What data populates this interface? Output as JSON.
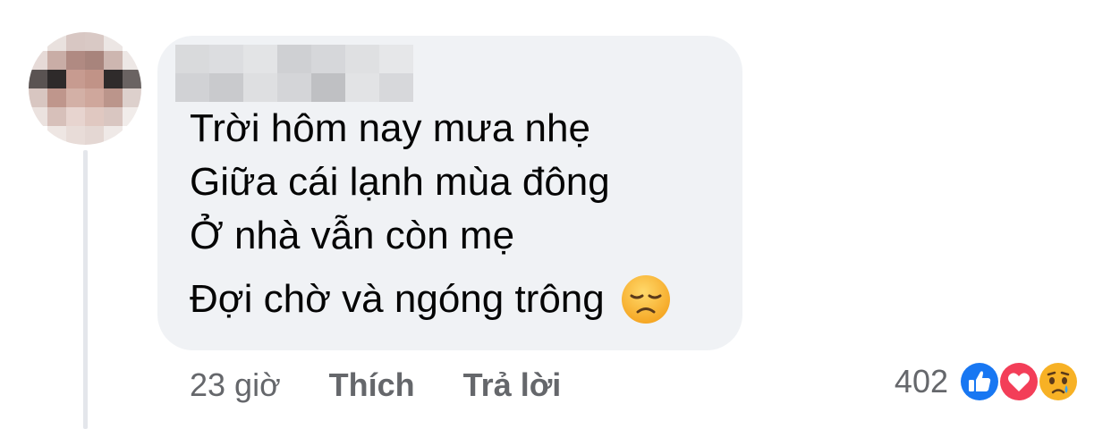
{
  "comment": {
    "lines": [
      "Trời hôm nay mưa nhẹ",
      "Giữa cái lạnh mùa đông",
      "Ở nhà vẫn còn mẹ",
      "Đợi chờ và ngóng trông"
    ],
    "trailing_emoji": "disappointed-face-emoji"
  },
  "meta": {
    "time": "23 giờ",
    "like_label": "Thích",
    "reply_label": "Trả lời"
  },
  "reactions": {
    "count": "402",
    "icons": [
      "like-icon",
      "love-icon",
      "sad-icon"
    ]
  },
  "colors": {
    "bubble": "#f0f2f5",
    "muted_text": "#65676b",
    "like_blue": "#1877f2",
    "love_red": "#f33e58",
    "emoji_yellow": "#f7b125"
  }
}
